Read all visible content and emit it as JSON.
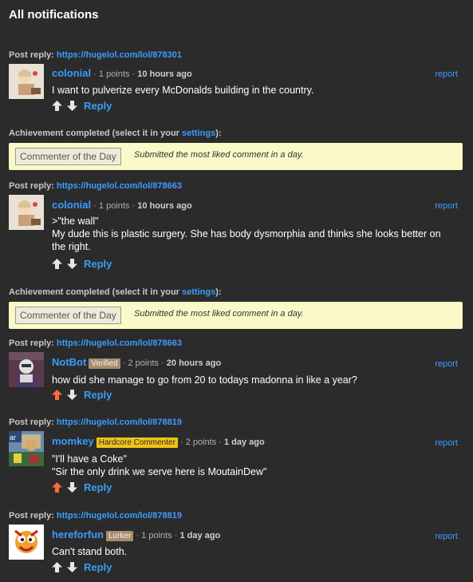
{
  "page": {
    "title": "All notifications"
  },
  "labels": {
    "post_reply": "Post reply:",
    "achievement": "Achievement completed (select it in your ",
    "achievement_link": "settings",
    "achievement_end": "):",
    "report": "report",
    "reply": "Reply"
  },
  "colors": {
    "bg": "#2b2b2b",
    "link": "#3a9cff",
    "upvoted": "#ff6a3d",
    "achievement_bg": "#fafac8",
    "hardcore_badge": "#f0c419",
    "lurker_badge": "#a88b6e"
  },
  "notifications": [
    {
      "type": "reply",
      "link": "https://hugelol.com/lol/878301",
      "user": "colonial",
      "badge": "",
      "points": "1 points",
      "ago": "10 hours ago",
      "lines": [
        "I want to pulverize every McDonalds building in the country."
      ],
      "upvoted": false
    },
    {
      "type": "achievement",
      "name": "Commenter of the Day",
      "desc": "Submitted the most liked comment in a day."
    },
    {
      "type": "reply",
      "link": "https://hugelol.com/lol/878663",
      "user": "colonial",
      "badge": "",
      "points": "1 points",
      "ago": "10 hours ago",
      "lines": [
        ">\"the wall\"",
        "My dude this is plastic surgery. She has body dysmorphia and thinks she looks better on",
        "the right."
      ],
      "upvoted": false
    },
    {
      "type": "achievement",
      "name": "Commenter of the Day",
      "desc": "Submitted the most liked comment in a day."
    },
    {
      "type": "reply",
      "link": "https://hugelol.com/lol/878663",
      "user": "NotBot",
      "badge": "Verified",
      "points": "2 points",
      "ago": "20 hours ago",
      "lines": [
        "how did she manage to go from 20 to todays madonna in like a year?"
      ],
      "upvoted": true
    },
    {
      "type": "reply",
      "link": "https://hugelol.com/lol/878819",
      "user": "momkey",
      "badge": "Hardcore Commenter",
      "points": "2 points",
      "ago": "1 day ago",
      "lines": [
        "\"I'll have a Coke\"",
        "\"Sir the only drink we serve here is MoutainDew\""
      ],
      "upvoted": true
    },
    {
      "type": "reply",
      "link": "https://hugelol.com/lol/878819",
      "user": "hereforfun",
      "badge": "Lurker",
      "points": "1 points",
      "ago": "1 day ago",
      "lines": [
        "Can't stand both."
      ],
      "upvoted": false
    }
  ]
}
